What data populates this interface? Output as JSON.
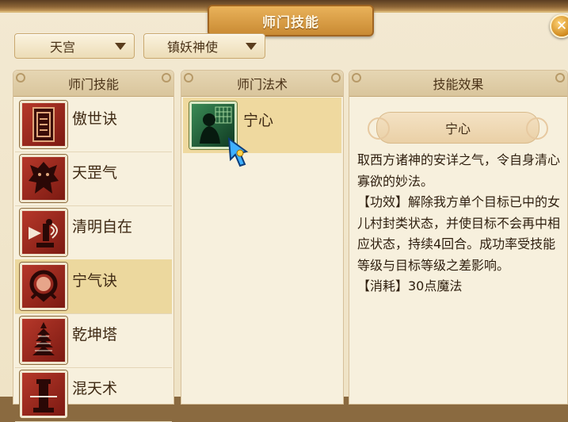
{
  "window": {
    "title": "师门技能",
    "close_label": "✕"
  },
  "filters": {
    "school": "天宫",
    "role": "镇妖神使"
  },
  "skills_panel": {
    "header": "师门技能",
    "items": [
      {
        "label": "傲世诀",
        "icon": "scroll-icon",
        "selected": false
      },
      {
        "label": "天罡气",
        "icon": "demon-statue-icon",
        "selected": false
      },
      {
        "label": "清明自在",
        "icon": "lightning-figure-icon",
        "selected": false
      },
      {
        "label": "宁气诀",
        "icon": "ring-icon",
        "selected": true
      },
      {
        "label": "乾坤塔",
        "icon": "pagoda-icon",
        "selected": false
      },
      {
        "label": "混天术",
        "icon": "tower-icon",
        "selected": false
      }
    ]
  },
  "spells_panel": {
    "header": "师门法术",
    "items": [
      {
        "label": "宁心",
        "icon": "meditating-figure-icon",
        "selected": true
      }
    ]
  },
  "effect_panel": {
    "header": "技能效果",
    "spell_name": "宁心",
    "lines": [
      "取西方诸神的安详之气，令自身清心寡欲的妙法。",
      "【功效】解除我方单个目标已中的女儿村封类状态，并使目标不会再中相应状态，持续4回合。成功率受技能等级与目标等级之差影响。",
      "【消耗】30点魔法"
    ]
  },
  "colors": {
    "accent": "#d08a1e",
    "panel_bg": "#f7f0dd",
    "selected_row": "#ecd89e",
    "text": "#3f2a14"
  }
}
